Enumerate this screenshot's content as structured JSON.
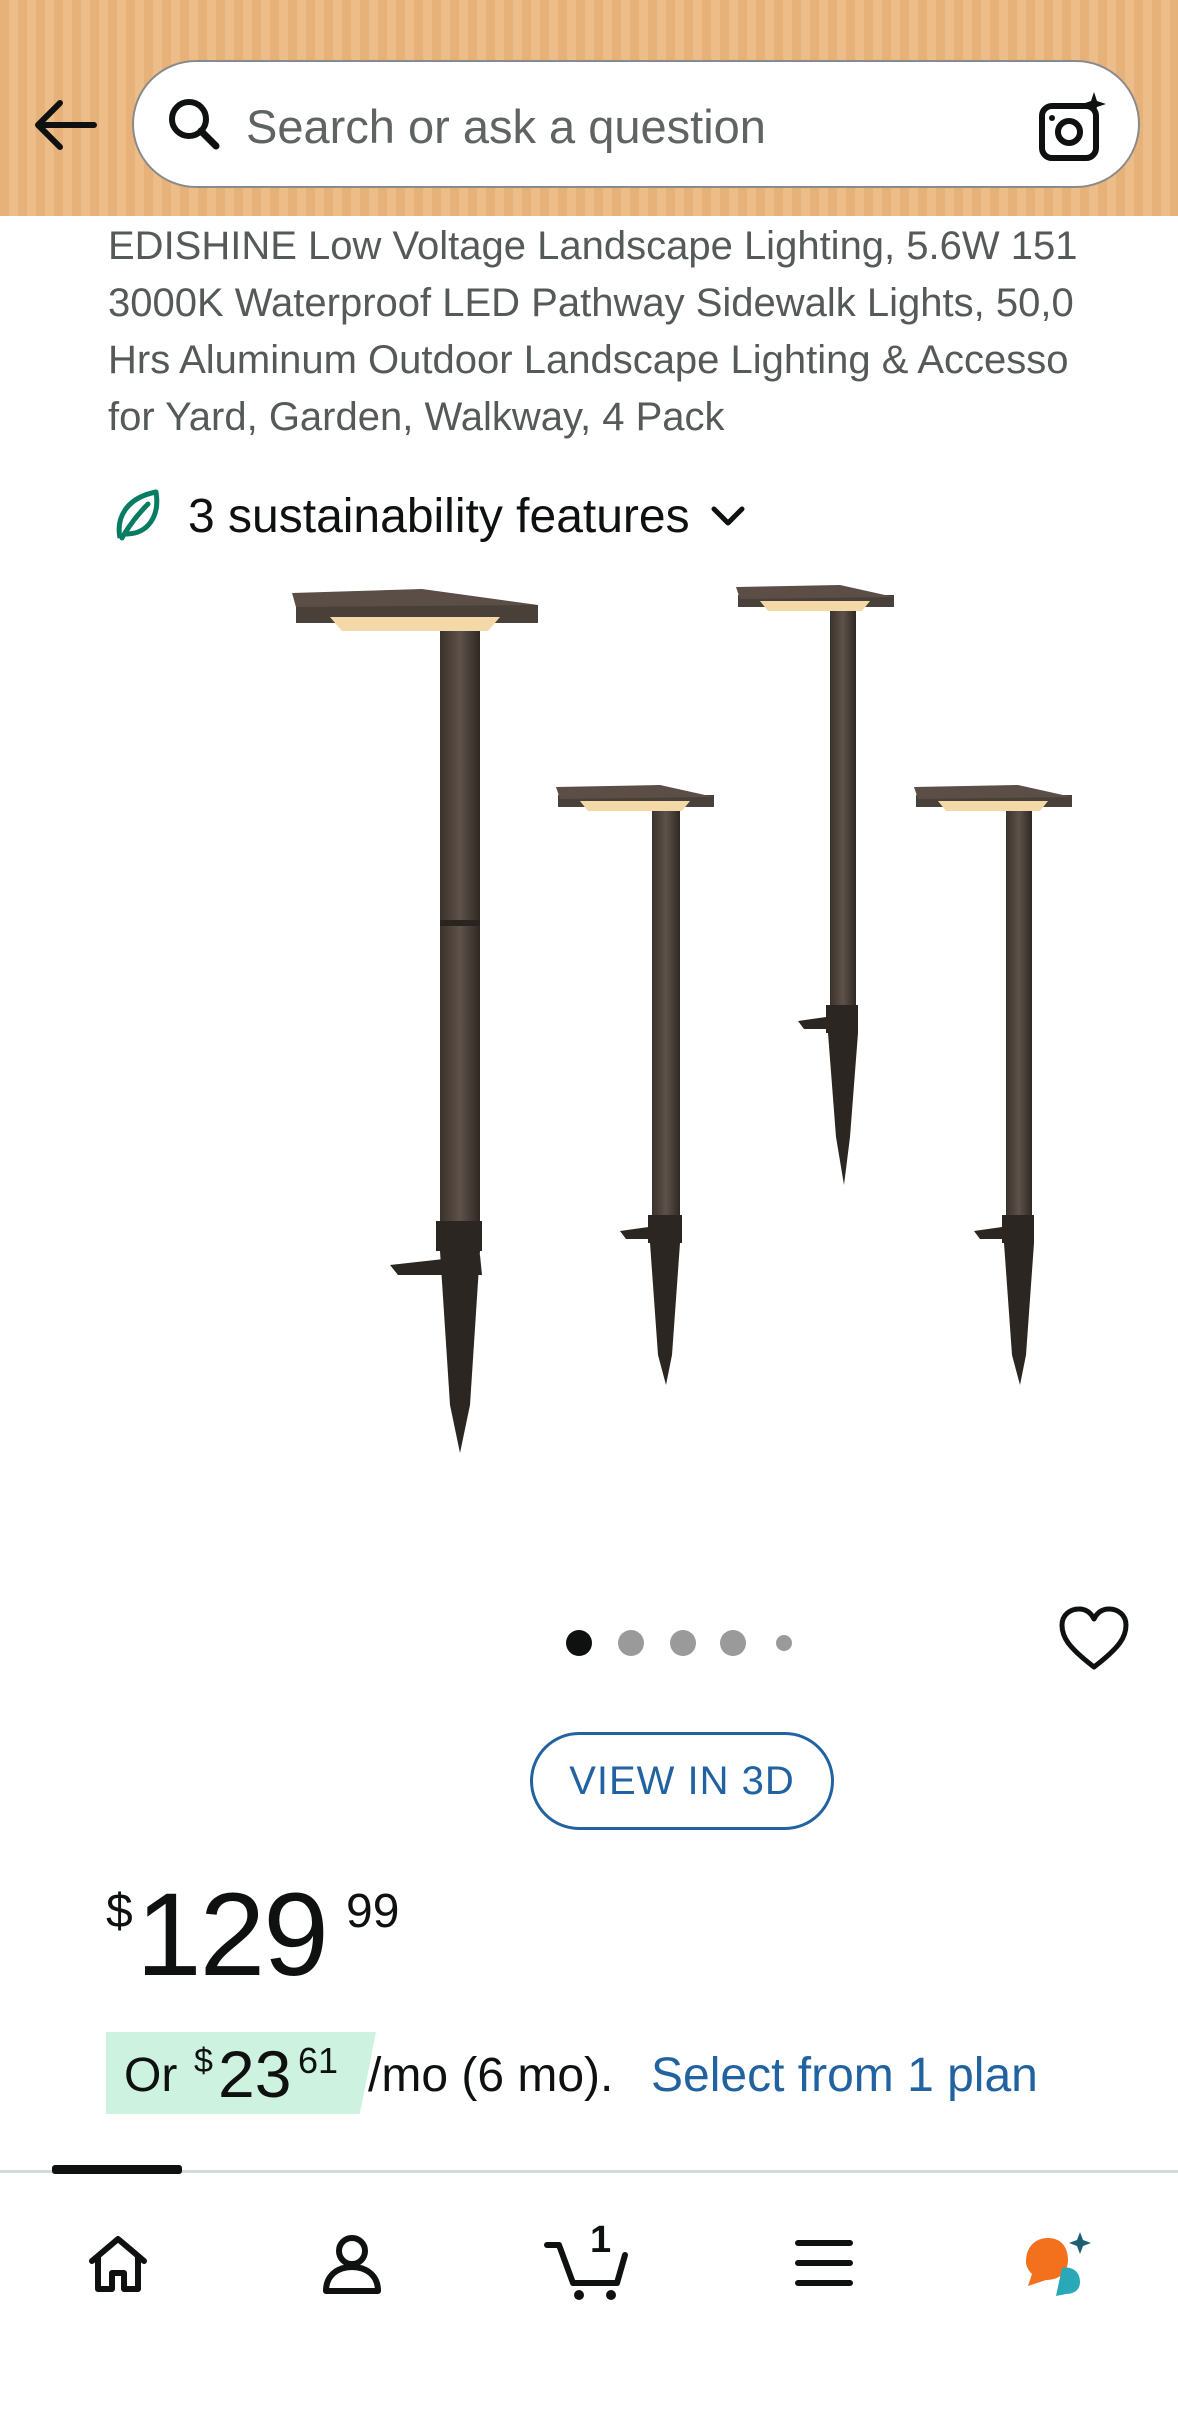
{
  "header": {
    "search_placeholder": "Search or ask a question",
    "background_color": "#e9b781",
    "icons": [
      "back-arrow-icon",
      "search-icon",
      "camera-search-icon"
    ]
  },
  "product": {
    "title_lines": [
      "EDISHINE Low Voltage Landscape Lighting, 5.6W 151",
      "3000K Waterproof LED Pathway Sidewalk Lights, 50,0",
      "Hrs Aluminum Outdoor Landscape Lighting & Accesso",
      "for Yard, Garden, Walkway, 4 Pack"
    ],
    "sustainability_label": "3 sustainability features",
    "image_description_icon": "pathway-lights-image",
    "carousel": {
      "total_dots": 5,
      "active_index": 0
    },
    "view_3d_label": "VIEW IN 3D"
  },
  "price": {
    "symbol": "$",
    "whole": "129",
    "fraction": "99"
  },
  "installment": {
    "or_label": "Or",
    "symbol": "$",
    "whole": "23",
    "fraction": "61",
    "term": "/mo (6 mo).",
    "link": "Select from 1 plan",
    "highlight_color": "#cdf2e0"
  },
  "bottom_nav": {
    "items": [
      "home-icon",
      "account-icon",
      "cart-icon",
      "menu-icon",
      "rufus-ai-icon"
    ],
    "cart_count": "1",
    "active_index": 0
  },
  "colors": {
    "link": "#2162a1",
    "text": "#0f1111",
    "muted": "#565959"
  }
}
